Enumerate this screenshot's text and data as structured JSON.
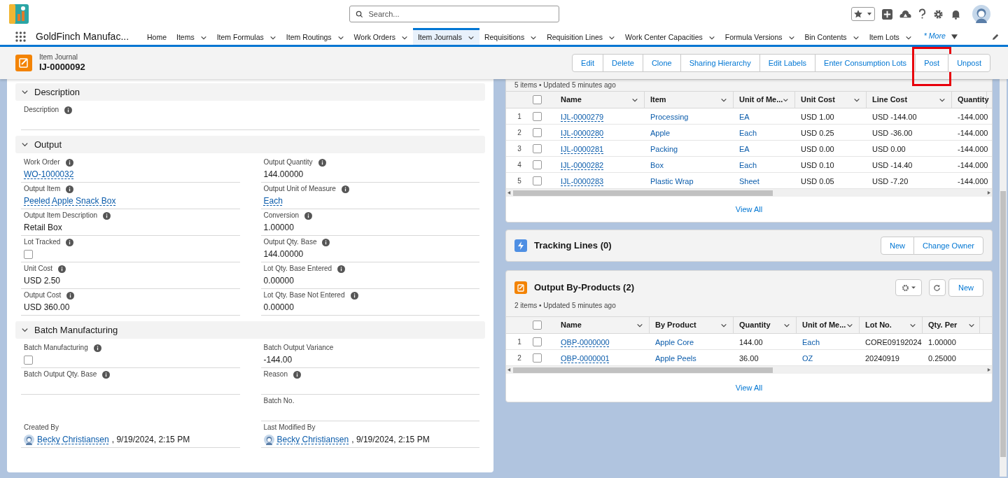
{
  "search": {
    "placeholder": "Search..."
  },
  "app": {
    "name": "GoldFinch Manufac...",
    "more": "* More"
  },
  "nav": [
    {
      "label": "Home",
      "has_menu": false,
      "selected": false
    },
    {
      "label": "Items",
      "has_menu": true,
      "selected": false
    },
    {
      "label": "Item Formulas",
      "has_menu": true,
      "selected": false
    },
    {
      "label": "Item Routings",
      "has_menu": true,
      "selected": false
    },
    {
      "label": "Work Orders",
      "has_menu": true,
      "selected": false
    },
    {
      "label": "Item Journals",
      "has_menu": true,
      "selected": true
    },
    {
      "label": "Requisitions",
      "has_menu": true,
      "selected": false
    },
    {
      "label": "Requisition Lines",
      "has_menu": true,
      "selected": false
    },
    {
      "label": "Work Center Capacities",
      "has_menu": true,
      "selected": false
    },
    {
      "label": "Formula Versions",
      "has_menu": true,
      "selected": false
    },
    {
      "label": "Bin Contents",
      "has_menu": true,
      "selected": false
    },
    {
      "label": "Item Lots",
      "has_menu": true,
      "selected": false
    }
  ],
  "record": {
    "type": "Item Journal",
    "name": "IJ-0000092",
    "actions": [
      {
        "label": "Edit",
        "highlighted": false
      },
      {
        "label": "Delete",
        "highlighted": false
      },
      {
        "label": "Clone",
        "highlighted": false
      },
      {
        "label": "Sharing Hierarchy",
        "highlighted": false
      },
      {
        "label": "Edit Labels",
        "highlighted": false
      },
      {
        "label": "Enter Consumption Lots",
        "highlighted": false
      },
      {
        "label": "Post",
        "highlighted": true
      },
      {
        "label": "Unpost",
        "highlighted": false
      }
    ]
  },
  "sections": [
    {
      "title": "Description",
      "expanded": true,
      "fields": [
        {
          "kind": "text",
          "label": "Description",
          "info": true
        }
      ]
    },
    {
      "title": "Output",
      "expanded": true,
      "fields": [
        {
          "kind": "link",
          "label": "Work Order",
          "info": true,
          "value": "WO-1000032"
        },
        {
          "kind": "text",
          "label": "Output Quantity",
          "info": true,
          "value": "144.00000"
        },
        {
          "kind": "link",
          "label": "Output Item",
          "info": true,
          "value": "Peeled Apple Snack Box"
        },
        {
          "kind": "link",
          "label": "Output Unit of Measure",
          "info": true,
          "value": "Each"
        },
        {
          "kind": "text",
          "label": "Output Item Description",
          "info": true,
          "value": "Retail Box"
        },
        {
          "kind": "text",
          "label": "Conversion",
          "info": true,
          "value": "1.00000"
        },
        {
          "kind": "checkbox",
          "label": "Lot Tracked",
          "info": true,
          "checked": false
        },
        {
          "kind": "text",
          "label": "Output Qty. Base",
          "info": true,
          "value": "144.00000"
        },
        {
          "kind": "text",
          "label": "Unit Cost",
          "info": true,
          "value": "USD 2.50"
        },
        {
          "kind": "text",
          "label": "Lot Qty. Base Entered",
          "info": true,
          "value": "0.00000"
        },
        {
          "kind": "text",
          "label": "Output Cost",
          "info": true,
          "value": "USD 360.00"
        },
        {
          "kind": "text",
          "label": "Lot Qty. Base Not Entered",
          "info": true,
          "value": "0.00000"
        }
      ]
    },
    {
      "title": "Batch Manufacturing",
      "expanded": true,
      "fields": [
        {
          "kind": "checkbox",
          "label": "Batch Manufacturing",
          "info": true,
          "checked": false
        },
        {
          "kind": "text",
          "label": "Batch Output Variance",
          "info": false,
          "value": "-144.00"
        },
        {
          "kind": "text",
          "label": "Batch Output Qty. Base",
          "info": true
        },
        {
          "kind": "text",
          "label": "Reason",
          "info": true
        },
        {
          "kind": "blank"
        },
        {
          "kind": "text",
          "label": "Batch No.",
          "info": false
        },
        {
          "kind": "user",
          "label": "Created By",
          "info": false,
          "value": "Becky Christiansen",
          "date": ", 9/19/2024, 2:15 PM"
        },
        {
          "kind": "user",
          "label": "Last Modified By",
          "info": false,
          "value": "Becky Christiansen",
          "date": ", 9/19/2024, 2:15 PM"
        }
      ]
    }
  ],
  "journal_lines": {
    "summary": "5 items • Updated 5 minutes ago",
    "all_checked": false,
    "columns": [
      {
        "label": "Name",
        "kind": "link"
      },
      {
        "label": "Item",
        "kind": "link"
      },
      {
        "label": "Unit of Me...",
        "kind": "link"
      },
      {
        "label": "Unit Cost",
        "kind": "text"
      },
      {
        "label": "Line Cost",
        "kind": "text"
      },
      {
        "label": "Quantity",
        "kind": "text"
      }
    ],
    "rows": [
      {
        "number": "1",
        "selected": false,
        "cells": [
          "IJL-0000279",
          "Processing",
          "EA",
          "USD 1.00",
          "USD -144.00",
          "-144.000"
        ]
      },
      {
        "number": "2",
        "selected": false,
        "cells": [
          "IJL-0000280",
          "Apple",
          "Each",
          "USD 0.25",
          "USD -36.00",
          "-144.000"
        ]
      },
      {
        "number": "3",
        "selected": false,
        "cells": [
          "IJL-0000281",
          "Packing",
          "EA",
          "USD 0.00",
          "USD 0.00",
          "-144.000"
        ]
      },
      {
        "number": "4",
        "selected": false,
        "cells": [
          "IJL-0000282",
          "Box",
          "Each",
          "USD 0.10",
          "USD -14.40",
          "-144.000"
        ]
      },
      {
        "number": "5",
        "selected": false,
        "cells": [
          "IJL-0000283",
          "Plastic Wrap",
          "Sheet",
          "USD 0.05",
          "USD -7.20",
          "-144.000"
        ]
      }
    ],
    "view_all": "View All"
  },
  "tracking_lines": {
    "title": "Tracking Lines (0)",
    "buttons": [
      "New",
      "Change Owner"
    ]
  },
  "by_products": {
    "title": "Output By-Products (2)",
    "summary": "2 items • Updated 5 minutes ago",
    "new_button": "New",
    "all_checked": false,
    "columns": [
      {
        "label": "Name",
        "kind": "link"
      },
      {
        "label": "By Product",
        "kind": "link"
      },
      {
        "label": "Quantity",
        "kind": "text"
      },
      {
        "label": "Unit of Me...",
        "kind": "link"
      },
      {
        "label": "Lot No.",
        "kind": "text"
      },
      {
        "label": "Qty. Per",
        "kind": "text"
      }
    ],
    "rows": [
      {
        "number": "1",
        "selected": false,
        "cells": [
          "OBP-0000000",
          "Apple Core",
          "144.00",
          "Each",
          "CORE09192024",
          "1.00000"
        ]
      },
      {
        "number": "2",
        "selected": false,
        "cells": [
          "OBP-0000001",
          "Apple Peels",
          "36.00",
          "OZ",
          "20240919",
          "0.25000"
        ]
      }
    ],
    "view_all": "View All"
  }
}
